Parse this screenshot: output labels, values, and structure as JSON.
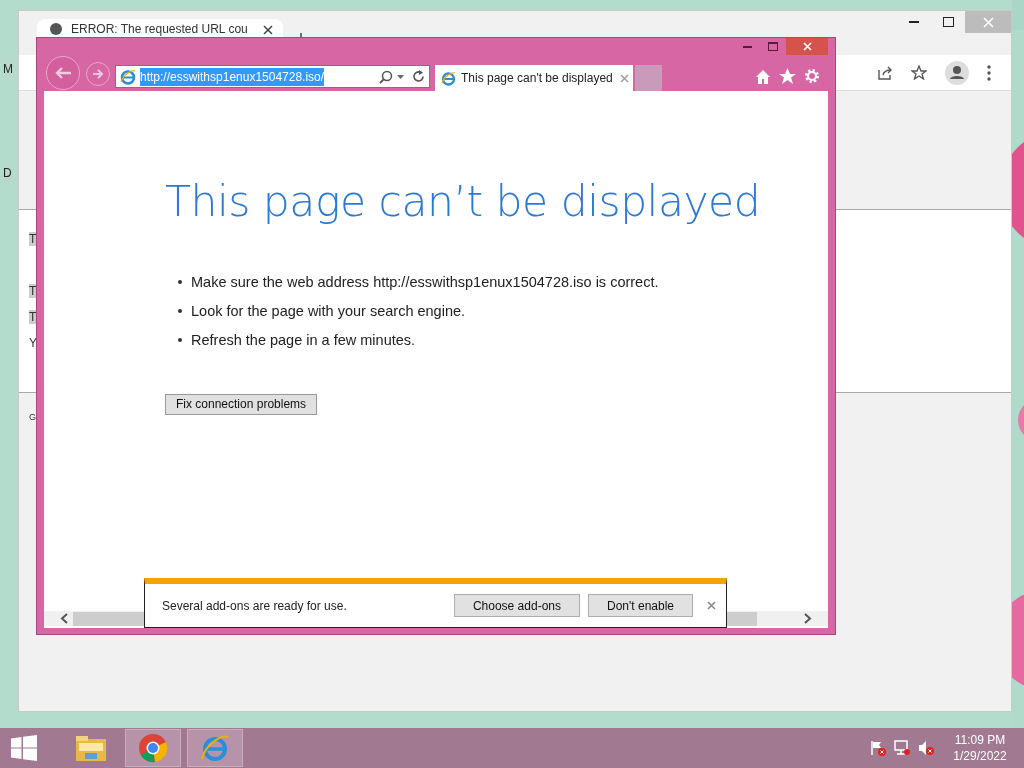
{
  "desktop": {
    "fragments": [
      "M",
      "D"
    ]
  },
  "chrome_window": {
    "tab_title": "ERROR: The requested URL cou",
    "page_fragments": [
      {
        "text": "T",
        "highlighted": true
      },
      {
        "text": "T",
        "highlighted": true
      },
      {
        "text": "T",
        "highlighted": true
      },
      {
        "text": "Y",
        "highlighted": false
      }
    ],
    "footer_fragment": "G"
  },
  "ie_window": {
    "address": "http://esswithsp1enux1504728.iso/",
    "address_selected": true,
    "tabs": [
      {
        "label": "This page can't be displayed",
        "selected": true
      }
    ],
    "page": {
      "heading": "This page can’t be displayed",
      "bullets": [
        "Make sure the web address http://esswithsp1enux1504728.iso is correct.",
        "Look for the page with your search engine.",
        "Refresh the page in a few minutes."
      ],
      "button": "Fix connection problems"
    },
    "notification": {
      "message": "Several add-ons are ready for use.",
      "buttons": [
        "Choose add-ons",
        "Don't enable"
      ]
    }
  },
  "taskbar": {
    "apps": [
      {
        "kind": "explorer",
        "active": false
      },
      {
        "kind": "chrome",
        "active": true
      },
      {
        "kind": "ie",
        "active": true
      }
    ],
    "time": "11:09 PM",
    "date": "1/29/2022"
  }
}
